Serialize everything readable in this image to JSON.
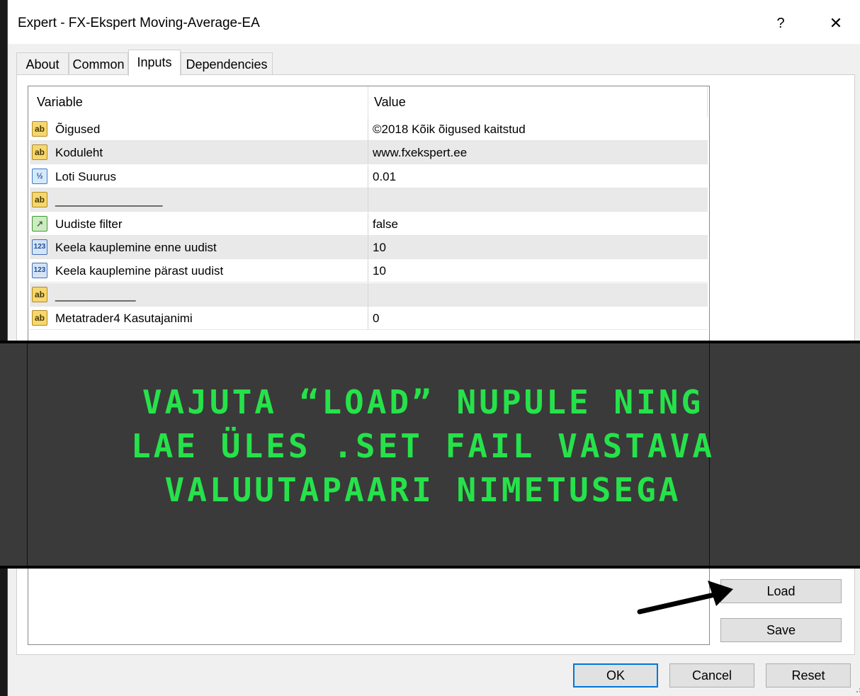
{
  "window": {
    "title": "Expert - FX-Ekspert Moving-Average-EA",
    "help_label": "?",
    "close_label": "✕"
  },
  "tabs": [
    {
      "label": "About"
    },
    {
      "label": "Common"
    },
    {
      "label": "Inputs"
    },
    {
      "label": "Dependencies"
    }
  ],
  "active_tab": "Inputs",
  "grid": {
    "headers": {
      "variable": "Variable",
      "value": "Value"
    },
    "rows": [
      {
        "icon": "ab",
        "variable": "Õigused",
        "value": "©2018 Kõik õigused kaitstud"
      },
      {
        "icon": "ab",
        "variable": "Koduleht",
        "value": "www.fxekspert.ee"
      },
      {
        "icon": "V2",
        "variable": "Loti Suurus",
        "value": "0.01"
      },
      {
        "icon": "ab",
        "variable": "________________",
        "value": ""
      },
      {
        "icon": "bool",
        "variable": "Uudiste filter",
        "value": "false"
      },
      {
        "icon": "123",
        "variable": "Keela kauplemine enne uudist",
        "value": "10"
      },
      {
        "icon": "123",
        "variable": "Keela kauplemine pärast uudist",
        "value": "10"
      },
      {
        "icon": "ab",
        "variable": "____________",
        "value": ""
      },
      {
        "icon": "ab",
        "variable": "Metatrader4 Kasutajanimi",
        "value": "0"
      }
    ]
  },
  "overlay": {
    "line1": "VAJUTA “LOAD” NUPULE NING",
    "line2": "LAE ÜLES .SET FAIL VASTAVA",
    "line3": "VALUUTAPAARI NIMETUSEGA",
    "color": "#26e24a"
  },
  "side_buttons": {
    "load": "Load",
    "save": "Save"
  },
  "footer_buttons": {
    "ok": "OK",
    "cancel": "Cancel",
    "reset": "Reset"
  },
  "icons": {
    "ab": "string-type-icon",
    "V2": "double-type-icon",
    "bool": "bool-type-icon",
    "123": "integer-type-icon"
  }
}
